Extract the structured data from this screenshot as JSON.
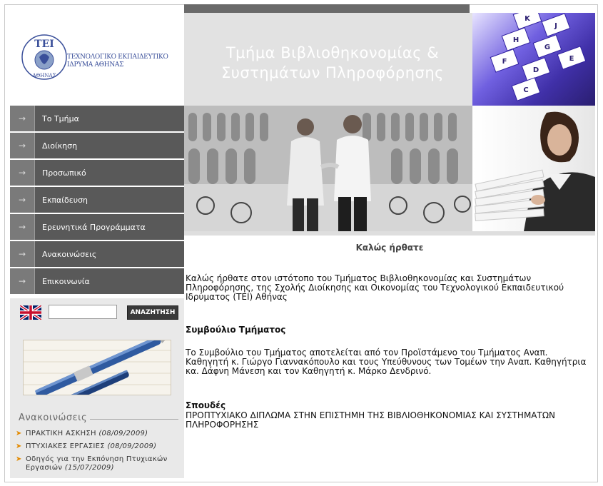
{
  "header": {
    "logo_text_line1": "ΤΕΧΝΟΛΟΓΙΚΟ ΕΚΠΑΙΔΕΥΤΙΚΟ",
    "logo_text_line2": "ΙΔΡΥΜΑ ΑΘΗΝΑΣ",
    "seal_top": "ΤΕΙ",
    "seal_bottom": "ΑΘΗΝΑΣ",
    "title_line1": "Τμήμα Βιβλιοθηκονομίας &",
    "title_line2": "Συστημάτων Πληροφόρησης"
  },
  "nav": {
    "arrow": "→",
    "items": [
      {
        "label": "Το Τμήμα"
      },
      {
        "label": "Διοίκηση"
      },
      {
        "label": "Προσωπικό"
      },
      {
        "label": "Εκπαίδευση"
      },
      {
        "label": "Ερευνητικά Προγράμματα"
      },
      {
        "label": "Ανακοινώσεις"
      },
      {
        "label": "Επικοινωνία"
      }
    ]
  },
  "search": {
    "value": "",
    "button_label": "ΑΝΑΖΗΤΗΣΗ",
    "flag_icon": "uk-flag-icon"
  },
  "announcements": {
    "title": "Ανακοινώσεις",
    "bullet": "➤",
    "items": [
      {
        "text": "ΠΡΑΚΤΙΚΗ ΑΣΚΗΣΗ",
        "date": "(08/09/2009)"
      },
      {
        "text": "ΠΤΥΧΙΑΚΕΣ ΕΡΓΑΣΙΕΣ",
        "date": "(08/09/2009)"
      },
      {
        "text": "Οδηγός για την Εκπόνηση Πτυχιακών Εργασιών",
        "date": "(15/07/2009)"
      }
    ]
  },
  "main": {
    "welcome_title": "Καλώς ήρθατε",
    "intro": "Καλώς ήρθατε στον ιστότοπο του Τμήματος Βιβλιοθηκονομίας και Συστημάτων Πληροφόρησης, της Σχολής Διοίκησης και Οικονομίας του Τεχνολογικού Εκπαιδευτικού Ιδρύματος (ΤΕΙ) Αθήνας",
    "council_heading": "Συμβούλιο Τμήματος",
    "council_text": "Το Συμβούλιο του Τμήματος αποτελείται από τον Προϊστάμενο του Τμήματος Αναπ. Καθηγητή κ. Γιώργο Γιαννακόπουλο και τους Υπεύθυνους των Τομέων την Αναπ. Καθηγήτρια κα. Δάφνη Μάνεση και τον Καθηγητή κ. Μάρκο Δενδρινό.",
    "studies_heading": "Σπουδές",
    "studies_text": "ΠΡΟΠΤΥΧΙΑΚΟ ΔΙΠΛΩΜΑ ΣΤΗΝ ΕΠΙΣΤΗΜΗ ΤΗΣ ΒΙΒΛΙΟΘΗΚΟΝΟΜΙΑΣ ΚΑΙ ΣΥΣΤΗΜΑΤΩΝ ΠΛΗΡΟΦΟΡΗΣΗΣ"
  },
  "images": {
    "index_tabs": [
      "K",
      "J",
      "H",
      "G",
      "F",
      "E",
      "D",
      "C"
    ]
  },
  "colors": {
    "nav_bg": "#595959",
    "accent_bullet": "#e38a00",
    "title_bg": "#e2e2e2"
  }
}
